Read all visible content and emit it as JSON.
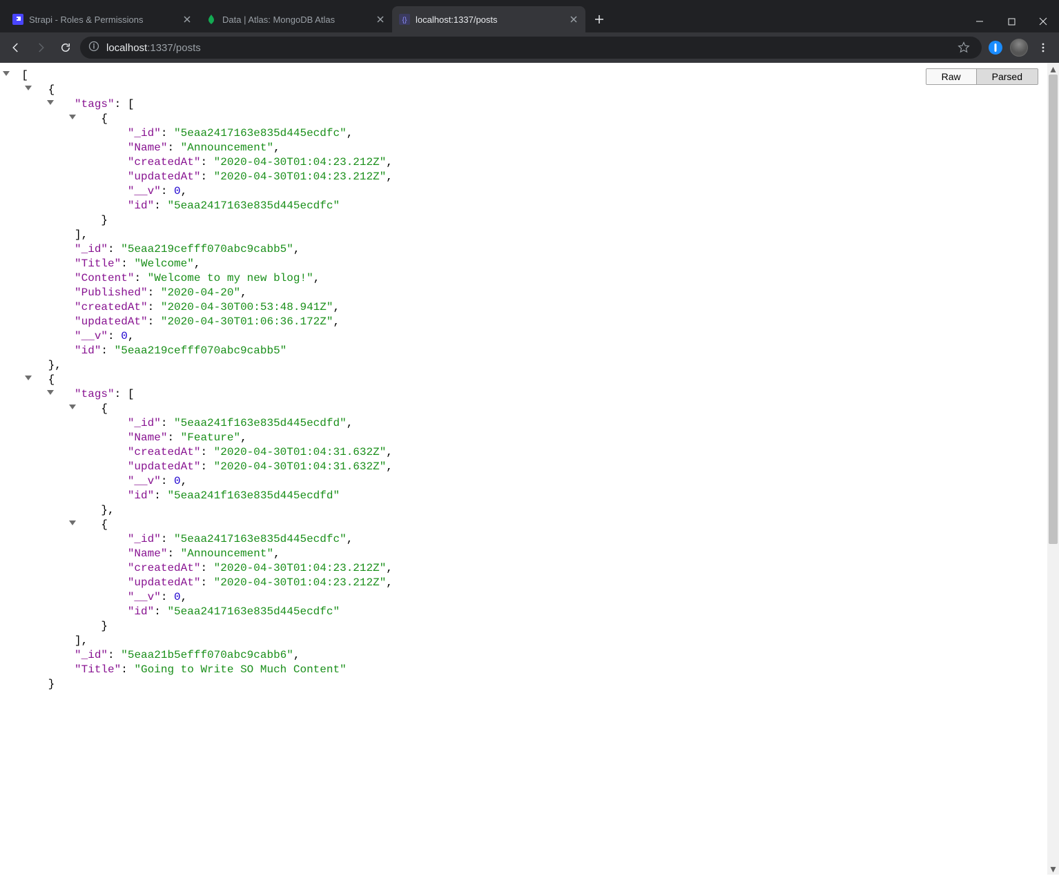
{
  "window": {
    "tabs": [
      {
        "title": "Strapi - Roles & Permissions",
        "icon": "strapi",
        "active": false
      },
      {
        "title": "Data | Atlas: MongoDB Atlas",
        "icon": "mongo",
        "active": false
      },
      {
        "title": "localhost:1337/posts",
        "icon": "strapi-api",
        "active": true
      }
    ]
  },
  "address": {
    "host": "localhost",
    "rest": ":1337/posts",
    "display": "localhost:1337/posts"
  },
  "json_viewer": {
    "raw_label": "Raw",
    "parsed_label": "Parsed",
    "active_view": "Parsed"
  },
  "response": [
    {
      "tags": [
        {
          "_id": "5eaa2417163e835d445ecdfc",
          "Name": "Announcement",
          "createdAt": "2020-04-30T01:04:23.212Z",
          "updatedAt": "2020-04-30T01:04:23.212Z",
          "__v": 0,
          "id": "5eaa2417163e835d445ecdfc"
        }
      ],
      "_id": "5eaa219cefff070abc9cabb5",
      "Title": "Welcome",
      "Content": "Welcome to my new blog!",
      "Published": "2020-04-20",
      "createdAt": "2020-04-30T00:53:48.941Z",
      "updatedAt": "2020-04-30T01:06:36.172Z",
      "__v": 0,
      "id": "5eaa219cefff070abc9cabb5"
    },
    {
      "tags": [
        {
          "_id": "5eaa241f163e835d445ecdfd",
          "Name": "Feature",
          "createdAt": "2020-04-30T01:04:31.632Z",
          "updatedAt": "2020-04-30T01:04:31.632Z",
          "__v": 0,
          "id": "5eaa241f163e835d445ecdfd"
        },
        {
          "_id": "5eaa2417163e835d445ecdfc",
          "Name": "Announcement",
          "createdAt": "2020-04-30T01:04:23.212Z",
          "updatedAt": "2020-04-30T01:04:23.212Z",
          "__v": 0,
          "id": "5eaa2417163e835d445ecdfc"
        }
      ],
      "_id": "5eaa21b5efff070abc9cabb6",
      "Title": "Going to Write SO Much Content"
    }
  ]
}
